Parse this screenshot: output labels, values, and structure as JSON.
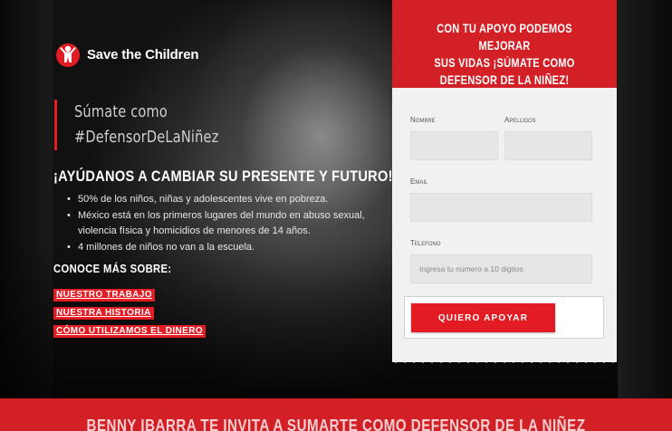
{
  "brand": {
    "name": "Save the Children",
    "logo_icon": "save-the-children-figure-icon",
    "accent_color": "#e31b23"
  },
  "hero": {
    "tagline_line1": "Súmate como",
    "tagline_line2": "#DefensorDeLaNiñez",
    "headline": "¡AYÚDANOS A CAMBIAR SU PRESENTE Y FUTURO!",
    "bullets": [
      "50% de los niños, niñas y adolescentes vive en pobreza.",
      "México está en los primeros lugares del mundo en abuso sexual, violencia física y homicidios de menores de 14 años.",
      "4 millones de niños no van a la escuela."
    ],
    "more_title": "CONOCE MÁS SOBRE:",
    "links": [
      "NUESTRO TRABAJO",
      "NUESTRA HISTORIA",
      "CÓMO UTILIZAMOS EL DINERO"
    ]
  },
  "form": {
    "header_line1": "CON TU APOYO PODEMOS MEJORAR",
    "header_line2": "SUS VIDAS ¡SÚMATE COMO",
    "header_line3": "DEFENSOR DE LA NIÑEZ!",
    "nombre_label": "Nombre",
    "apellidos_label": "Apellidos",
    "email_label": "Email",
    "telefono_label": "Telefono",
    "telefono_placeholder": "Ingresa tu numero a 10 digitos",
    "submit_label": "QUIERO APOYAR"
  },
  "footer": {
    "banner_text": "BENNY IBARRA TE INVITA A SUMARTE COMO DEFENSOR DE LA NIÑEZ"
  }
}
